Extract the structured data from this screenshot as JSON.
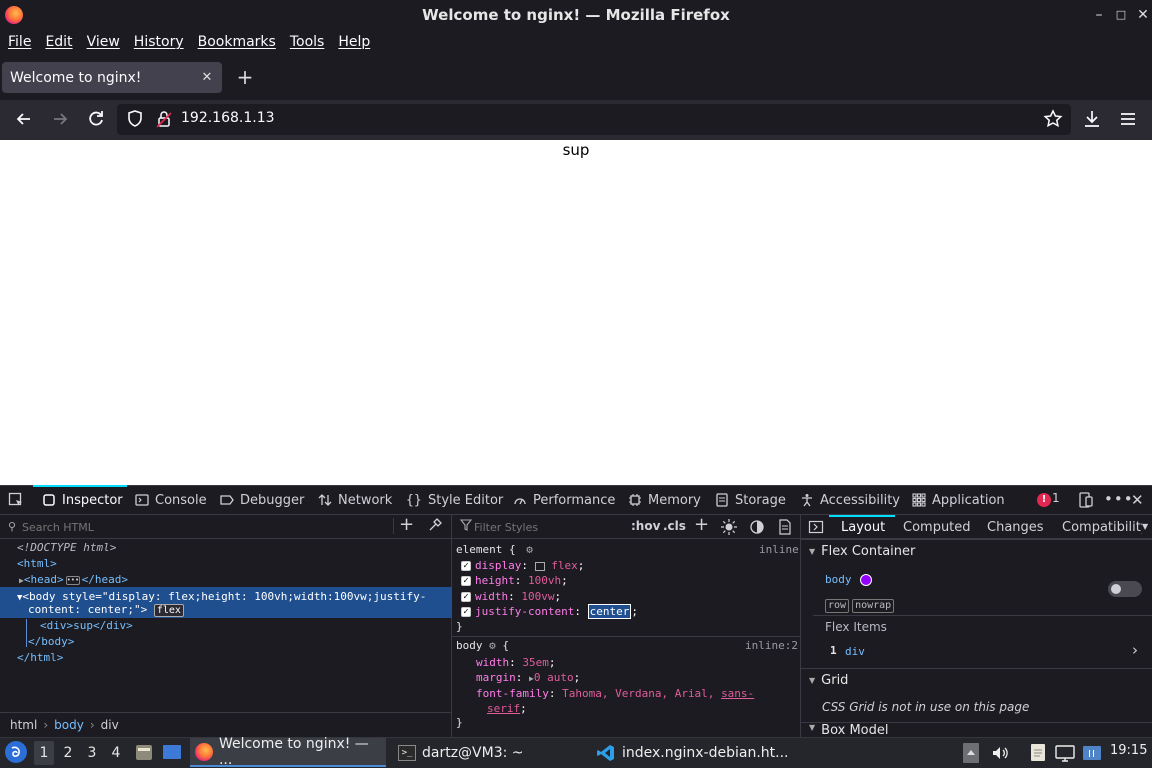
{
  "window": {
    "title": "Welcome to nginx! — Mozilla Firefox"
  },
  "menu": [
    "File",
    "Edit",
    "View",
    "History",
    "Bookmarks",
    "Tools",
    "Help"
  ],
  "tab": {
    "title": "Welcome to nginx!"
  },
  "url": "192.168.1.13",
  "page": {
    "text": "sup"
  },
  "devtools": {
    "tabs": [
      "Inspector",
      "Console",
      "Debugger",
      "Network",
      "Style Editor",
      "Performance",
      "Memory",
      "Storage",
      "Accessibility",
      "Application"
    ],
    "error_count": "1",
    "search_placeholder": "Search HTML",
    "tree": {
      "doctype": "<!DOCTYPE html>",
      "html_open": "<html>",
      "head": "<head>",
      "head_close": "</head>",
      "body_open_1": "<body style=\"display: flex;height: 100vh;width:100vw;justify-",
      "body_open_2": "content: center;\">",
      "flex_badge": "flex",
      "div": "<div>sup</div>",
      "body_close": "</body>",
      "html_close": "</html>"
    },
    "breadcrumbs": [
      "html",
      "body",
      "div"
    ],
    "rules": {
      "filter_placeholder": "Filter Styles",
      "hov": ":hov",
      "cls": ".cls",
      "element_selector": "element {",
      "element_source": "inline",
      "element_props": [
        {
          "name": "display",
          "value": "flex"
        },
        {
          "name": "height",
          "value": "100vh"
        },
        {
          "name": "width",
          "value": "100vw"
        },
        {
          "name": "justify-content",
          "value": "center"
        }
      ],
      "close_brace": "}",
      "body_selector": "body",
      "body_open_brace": "{",
      "body_source": "inline:2",
      "body_props": [
        {
          "name": "width",
          "value": "35em"
        },
        {
          "name": "margin",
          "value": "0 auto"
        },
        {
          "name": "font-family",
          "value": "Tahoma, Verdana, Arial,"
        }
      ],
      "sans_1": "sans-",
      "sans_2": "serif"
    },
    "layout": {
      "tabs": [
        "Layout",
        "Computed",
        "Changes",
        "Compatibility"
      ],
      "flex_container_label": "Flex Container",
      "element": "body",
      "badges": [
        "row",
        "nowrap"
      ],
      "flex_items_label": "Flex Items",
      "item_index": "1",
      "item_name": "div",
      "grid_label": "Grid",
      "grid_note": "CSS Grid is not in use on this page",
      "box_model_label": "Box Model"
    }
  },
  "taskbar": {
    "workspaces": [
      "1",
      "2",
      "3",
      "4"
    ],
    "tasks": [
      "Welcome to nginx! — ...",
      "dartz@VM3: ~",
      "index.nginx-debian.ht..."
    ],
    "clock": "19:15"
  },
  "colors": {
    "accent": "#00ddff",
    "selection": "#1f4f8f"
  }
}
